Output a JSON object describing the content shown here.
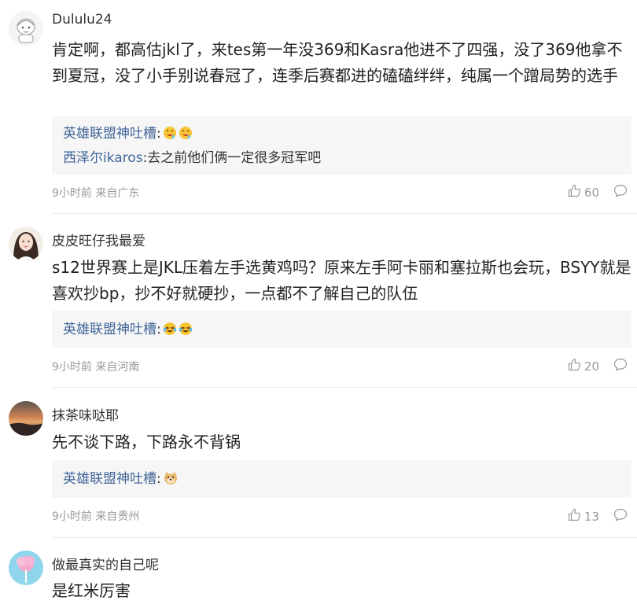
{
  "comments": [
    {
      "username": "Dululu24",
      "content": "肯定啊，都高估jkl了，来tes第一年没369和Kasra他进不了四强，没了369他拿不到夏冠，没了小手别说春冠了，连季后赛都进的磕磕绊绊，纯属一个蹭局势的选手",
      "replies": [
        {
          "author": "英雄联盟神吐槽",
          "sep": ":",
          "text": "",
          "emoji": "drooling-face-emoji"
        },
        {
          "author": "西泽尔ikaros",
          "sep": ":",
          "text": "去之前他们俩一定很多冠军吧",
          "emoji": ""
        }
      ],
      "meta": "9小时前 来自广东",
      "likes": "60",
      "avatar": "doodle-avatar"
    },
    {
      "username": "皮皮旺仔我最爱",
      "content": "s12世界赛上是JKL压着左手选黄鸡吗？原来左手阿卡丽和塞拉斯也会玩，BSYY就是喜欢抄bp，抄不好就硬抄，一点都不了解自己的队伍",
      "replies": [
        {
          "author": "英雄联盟神吐槽",
          "sep": ":",
          "text": "",
          "emoji": "crying-laughing-emoji"
        }
      ],
      "meta": "9小时前 来自河南",
      "likes": "20",
      "avatar": "girl-avatar"
    },
    {
      "username": "抹茶味哒耶",
      "content": "先不谈下路，下路永不背锅",
      "replies": [
        {
          "author": "英雄联盟神吐槽",
          "sep": ":",
          "text": "",
          "emoji": "doge-emoji"
        }
      ],
      "meta": "9小时前 来自贵州",
      "likes": "13",
      "avatar": "sunset-avatar"
    },
    {
      "username": "做最真实的自己呢",
      "content": "是红米厉害",
      "replies": [],
      "meta": "",
      "likes": "",
      "avatar": "cotton-candy-avatar"
    }
  ],
  "colors": {
    "link": "#406599",
    "meta": "#999999",
    "reply_bg": "#f6f6f6"
  }
}
